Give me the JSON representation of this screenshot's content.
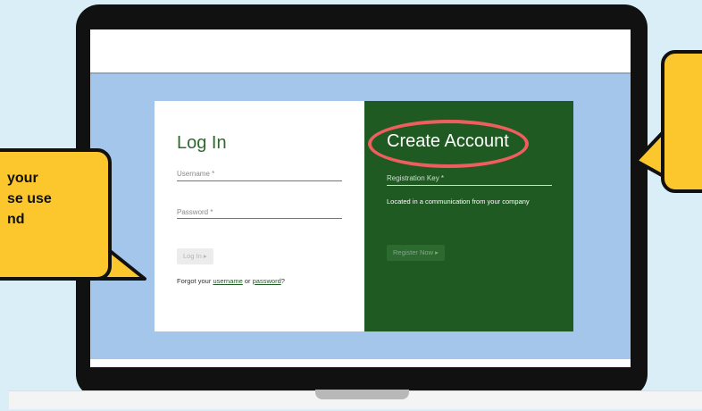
{
  "login": {
    "title": "Log In",
    "username_label": "Username *",
    "password_label": "Password *",
    "login_button": "Log In ▸",
    "forgot_prefix": "Forgot your ",
    "username_link": "username",
    "forgot_or": " or ",
    "password_link": "password",
    "forgot_suffix": "?"
  },
  "create_account": {
    "title": "Create Account",
    "registration_key_label": "Registration Key *",
    "hint": "Located in a communication from your company",
    "register_button": "Register Now ▸"
  },
  "callout_left": {
    "lines": [
      "your",
      "se use",
      "nd"
    ]
  },
  "colors": {
    "accent_green": "#1f5a22",
    "highlight_red": "#ef5e5e",
    "callout_yellow": "#fcc72d"
  }
}
